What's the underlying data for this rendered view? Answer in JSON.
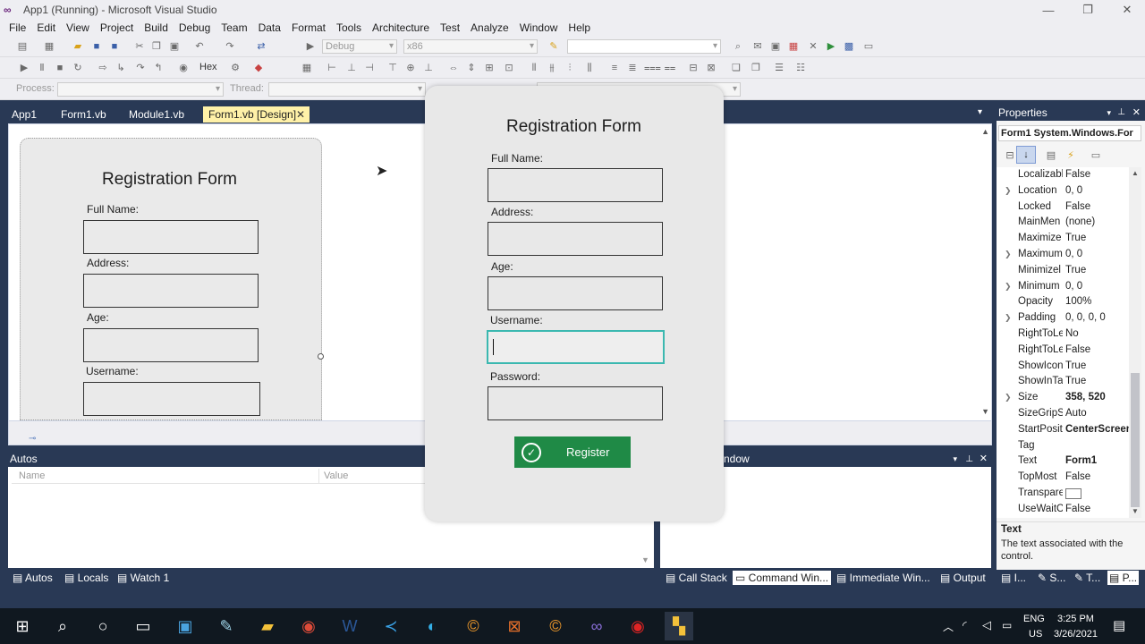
{
  "window": {
    "title": "App1 (Running) - Microsoft Visual Studio"
  },
  "menu": [
    "File",
    "Edit",
    "View",
    "Project",
    "Build",
    "Debug",
    "Team",
    "Data",
    "Format",
    "Tools",
    "Architecture",
    "Test",
    "Analyze",
    "Window",
    "Help"
  ],
  "toolbar": {
    "config": "Debug",
    "platform": "x86",
    "hex_label": "Hex",
    "process_label": "Process:",
    "thread_label": "Thread:"
  },
  "doc_tabs": [
    "App1",
    "Form1.vb",
    "Module1.vb",
    "Form1.vb [Design]"
  ],
  "designer_form": {
    "title": "Registration Form",
    "labels": [
      "Full Name:",
      "Address:",
      "Age:",
      "Username:"
    ]
  },
  "run_form": {
    "title": "Registration Form",
    "labels": [
      "Full Name:",
      "Address:",
      "Age:",
      "Username:",
      "Password:"
    ],
    "button": "Register"
  },
  "properties": {
    "header": "Properties",
    "object": "Form1  System.Windows.For",
    "rows": [
      {
        "name": "Localizabl",
        "value": "False",
        "expand": false
      },
      {
        "name": "Location",
        "value": "0, 0",
        "expand": true
      },
      {
        "name": "Locked",
        "value": "False",
        "expand": false
      },
      {
        "name": "MainMen",
        "value": "(none)",
        "expand": false
      },
      {
        "name": "Maximize",
        "value": "True",
        "expand": false
      },
      {
        "name": "Maximum",
        "value": "0, 0",
        "expand": true
      },
      {
        "name": "Minimizel",
        "value": "True",
        "expand": false
      },
      {
        "name": "Minimum",
        "value": "0, 0",
        "expand": true
      },
      {
        "name": "Opacity",
        "value": "100%",
        "expand": false
      },
      {
        "name": "Padding",
        "value": "0, 0, 0, 0",
        "expand": true
      },
      {
        "name": "RightToLe",
        "value": "No",
        "expand": false
      },
      {
        "name": "RightToLe",
        "value": "False",
        "expand": false
      },
      {
        "name": "ShowIcon",
        "value": "True",
        "expand": false
      },
      {
        "name": "ShowInTa",
        "value": "True",
        "expand": false
      },
      {
        "name": "Size",
        "value": "358, 520",
        "expand": true,
        "bold": true
      },
      {
        "name": "SizeGripSt",
        "value": "Auto",
        "expand": false
      },
      {
        "name": "StartPositi",
        "value": "CenterScreen",
        "expand": false,
        "bold": true
      },
      {
        "name": "Tag",
        "value": "",
        "expand": false
      },
      {
        "name": "Text",
        "value": "Form1",
        "expand": false,
        "bold": true
      },
      {
        "name": "TopMost",
        "value": "False",
        "expand": false
      },
      {
        "name": "Transparer",
        "value": "",
        "expand": false
      },
      {
        "name": "UseWaitC",
        "value": "False",
        "expand": false
      }
    ],
    "desc_title": "Text",
    "desc_text": "The text associated with the control."
  },
  "autos": {
    "title": "Autos",
    "col_name": "Name",
    "col_value": "Value"
  },
  "right_panel": {
    "title": "ndow"
  },
  "bottom_tabs_left": [
    "Autos",
    "Locals",
    "Watch 1"
  ],
  "bottom_tabs_right": [
    "Call Stack",
    "Command Win...",
    "Immediate Win...",
    "Output",
    "I...",
    "S...",
    "T...",
    "P..."
  ],
  "tray": {
    "lang": "ENG",
    "region": "US",
    "time": "3:25 PM",
    "date": "3/26/2021"
  }
}
